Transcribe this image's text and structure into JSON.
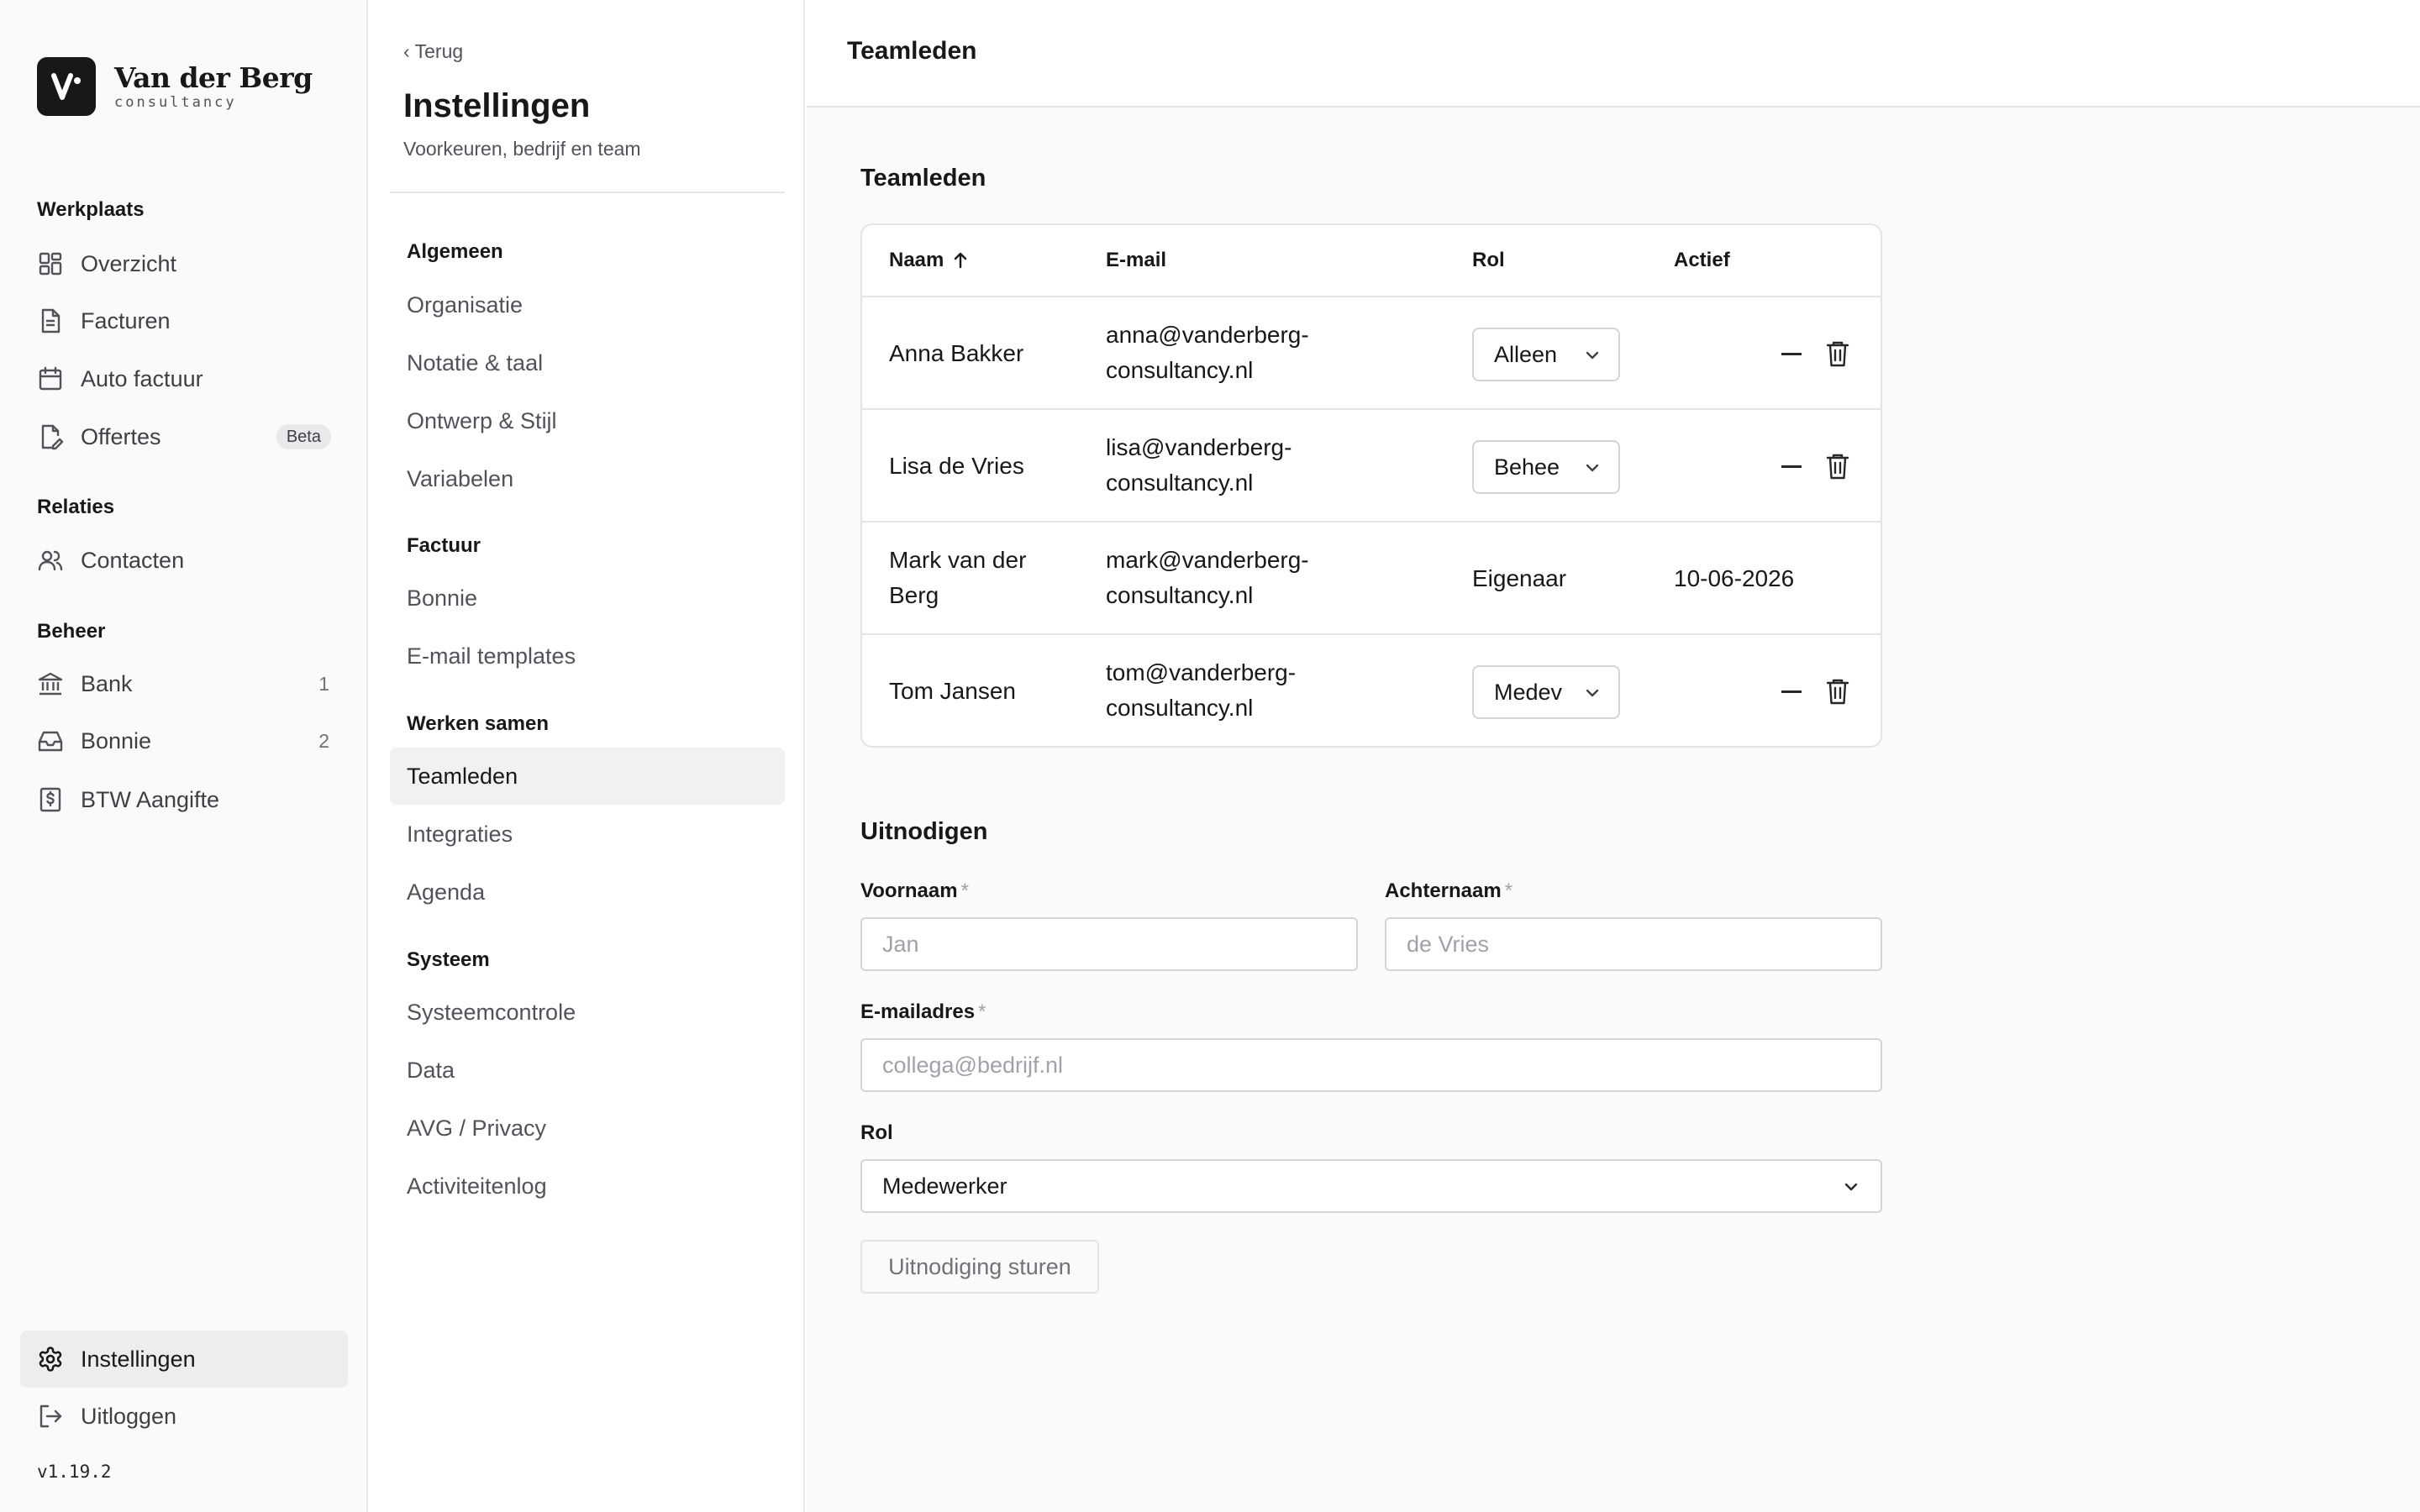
{
  "brand": {
    "name": "Van der Berg",
    "sub": "consultancy"
  },
  "sidebar": {
    "sections": [
      {
        "title": "Werkplaats"
      },
      {
        "title": "Relaties"
      },
      {
        "title": "Beheer"
      }
    ],
    "items": [
      {
        "label": "Overzicht",
        "icon": "grid-icon"
      },
      {
        "label": "Facturen",
        "icon": "document-icon"
      },
      {
        "label": "Auto factuur",
        "icon": "calendar-icon"
      },
      {
        "label": "Offertes",
        "icon": "document-edit-icon",
        "badge": "Beta"
      },
      {
        "label": "Contacten",
        "icon": "users-icon"
      },
      {
        "label": "Bank",
        "icon": "bank-icon",
        "count": "1"
      },
      {
        "label": "Bonnie",
        "icon": "inbox-icon",
        "count": "2"
      },
      {
        "label": "BTW Aangifte",
        "icon": "receipt-dollar-icon"
      }
    ],
    "bottom": [
      {
        "label": "Instellingen",
        "icon": "gear-icon",
        "active": true
      },
      {
        "label": "Uitloggen",
        "icon": "logout-icon"
      }
    ],
    "version": "v1.19.2"
  },
  "settings": {
    "back": "‹ Terug",
    "title": "Instellingen",
    "subtitle": "Voorkeuren, bedrijf en team",
    "groups": [
      {
        "title": "Algemeen",
        "items": [
          "Organisatie",
          "Notatie & taal",
          "Ontwerp & Stijl",
          "Variabelen"
        ]
      },
      {
        "title": "Factuur",
        "items": [
          "Bonnie",
          "E-mail templates"
        ]
      },
      {
        "title": "Werken samen",
        "items": [
          "Teamleden",
          "Integraties",
          "Agenda"
        ]
      },
      {
        "title": "Systeem",
        "items": [
          "Systeemcontrole",
          "Data",
          "AVG / Privacy",
          "Activiteitenlog"
        ]
      }
    ],
    "active": "Teamleden"
  },
  "main": {
    "title": "Teamleden",
    "team": {
      "title": "Teamleden",
      "columns": [
        "Naam",
        "E-mail",
        "Rol",
        "Actief"
      ],
      "rows": [
        {
          "name": "Anna Bakker",
          "email_1": "anna@vanderberg-",
          "email_2": "consultancy.nl",
          "role": "Alleen",
          "editable": true,
          "active": ""
        },
        {
          "name": "Lisa de Vries",
          "email_1": "lisa@vanderberg-",
          "email_2": "consultancy.nl",
          "role": "Behee",
          "editable": true,
          "active": ""
        },
        {
          "name_1": "Mark van der",
          "name_2": "Berg",
          "email_1": "mark@vanderberg-",
          "email_2": "consultancy.nl",
          "role": "Eigenaar",
          "editable": false,
          "active": "10-06-2026"
        },
        {
          "name": "Tom Jansen",
          "email_1": "tom@vanderberg-",
          "email_2": "consultancy.nl",
          "role": "Medev",
          "editable": true,
          "active": ""
        }
      ]
    },
    "invite": {
      "title": "Uitnodigen",
      "first_name": {
        "label": "Voornaam",
        "placeholder": "Jan"
      },
      "last_name": {
        "label": "Achternaam",
        "placeholder": "de Vries"
      },
      "email": {
        "label": "E-mailadres",
        "placeholder": "collega@bedrijf.nl"
      },
      "required_mark": "*",
      "role": {
        "label": "Rol",
        "value": "Medewerker"
      },
      "submit": "Uitnodiging sturen"
    }
  }
}
